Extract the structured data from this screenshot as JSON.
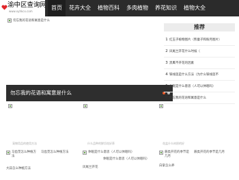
{
  "header": {
    "logo_title": "渝中区查询网",
    "logo_url": "www.xyhkcx.com",
    "nav": [
      "首页",
      "花卉大全",
      "植物百科",
      "多肉植物",
      "养花知识",
      "植物大全"
    ]
  },
  "slider": {
    "image_alt": "勿忘我的花语和寓意是什么",
    "caption": "勿忘我的花语和寓意是什么",
    "dots": 2,
    "active_dot": 0
  },
  "sidebar": {
    "heading": "推荐",
    "items": [
      {
        "num": "1",
        "text": "红玉子植物图片（熊童子和粉月图片）"
      },
      {
        "num": "2",
        "text": "凤尾兰开花什么时候（"
      },
      {
        "num": "3",
        "text": "黑鹰不开花的因素"
      },
      {
        "num": "4",
        "text": "铁线莲是什么方法（为什么铁线莲不"
      },
      {
        "num": "5",
        "text": "休眠是什么意思（人可以休眠吗）"
      },
      {
        "num": "6",
        "text": "勿忘我的花语和寓意是什么"
      }
    ]
  },
  "row_captions": [
    "宠物用品的使用方法",
    "什么品种的鲜切花好养",
    "花盆什么材质的好"
  ],
  "cards": [
    {
      "img_alt": "马齿苋怎么种植方法",
      "desc1": "马齿苋怎么种植方法",
      "desc2": "大蒜怎么种植方法"
    },
    {
      "img_alt": "休眠是什么意思（人可以休眠吗）",
      "desc1": "休眠是什么意思（人可以休眠吗）",
      "desc2": "凤尾兰开花"
    },
    {
      "img_alt": "蕨类开花的季节是几月",
      "desc1": "蕨类开花的季节是几月",
      "desc2": "白掌怎么养"
    }
  ]
}
